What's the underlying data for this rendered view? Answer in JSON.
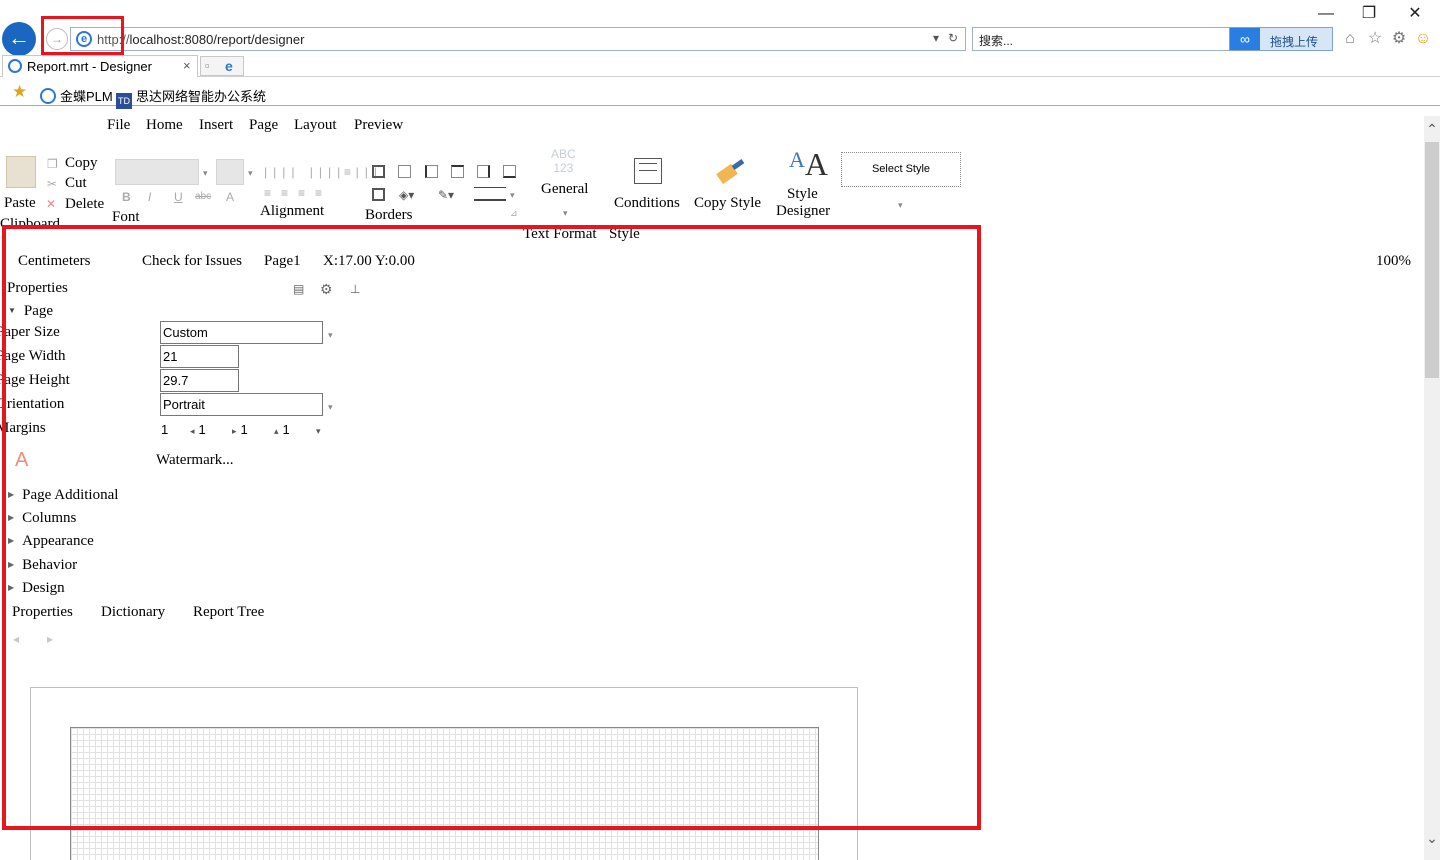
{
  "browser": {
    "window_buttons": {
      "minimize": "—",
      "restore": "❐",
      "close": "✕"
    },
    "address": {
      "scheme": "http://",
      "host_path": "localhost:8080/report/designer"
    },
    "search_placeholder": "搜索...",
    "upload_label": "拖拽上传",
    "tab": {
      "title": "Report.mrt - Designer",
      "close": "×"
    },
    "favorites": [
      {
        "label": "金蝶PLM",
        "icon": "ie-page-icon"
      },
      {
        "label": "思达网络智能办公系统",
        "icon": "td-logo-icon"
      }
    ]
  },
  "designer": {
    "menu": [
      "File",
      "Home",
      "Insert",
      "Page",
      "Layout",
      "Preview"
    ],
    "ribbon": {
      "clipboard": {
        "paste": "Paste",
        "copy": "Copy",
        "cut": "Cut",
        "delete": "Delete",
        "group": "Clipboard"
      },
      "font": {
        "group": "Font",
        "bold": "B",
        "italic": "I",
        "underline": "U",
        "strike": "abc",
        "color": "A"
      },
      "alignment": {
        "group": "Alignment"
      },
      "borders": {
        "group": "Borders"
      },
      "text_format": {
        "abc": "ABC",
        "num": "123",
        "label": "General",
        "group": "Text Format"
      },
      "conditions": "Conditions",
      "copy_style": "Copy Style",
      "style_designer": [
        "Style",
        "Designer"
      ],
      "select_style": "Select Style",
      "style_group": "Style"
    },
    "statusbar": {
      "units": "Centimeters",
      "check": "Check for Issues",
      "page": "Page1",
      "coords": "X:17.00 Y:0.00",
      "zoom": "100%"
    },
    "properties": {
      "header": "Properties",
      "page_section": "Page",
      "rows": {
        "paper_size": {
          "label": "Paper Size",
          "value": "Custom"
        },
        "page_width": {
          "label": "Page Width",
          "value": "21"
        },
        "page_height": {
          "label": "Page Height",
          "value": "29.7"
        },
        "orientation": {
          "label": "Orientation",
          "value": "Portrait"
        },
        "margins": {
          "label": "Margins",
          "all": "1",
          "left": "1",
          "right": "1",
          "top": "1"
        }
      },
      "watermark": "Watermark...",
      "categories": [
        "Page Additional",
        "Columns",
        "Appearance",
        "Behavior",
        "Design"
      ]
    },
    "panel_tabs": [
      "Properties",
      "Dictionary",
      "Report Tree"
    ]
  },
  "colors": {
    "highlight": "#e8141e",
    "accent": "#1a66c0"
  }
}
